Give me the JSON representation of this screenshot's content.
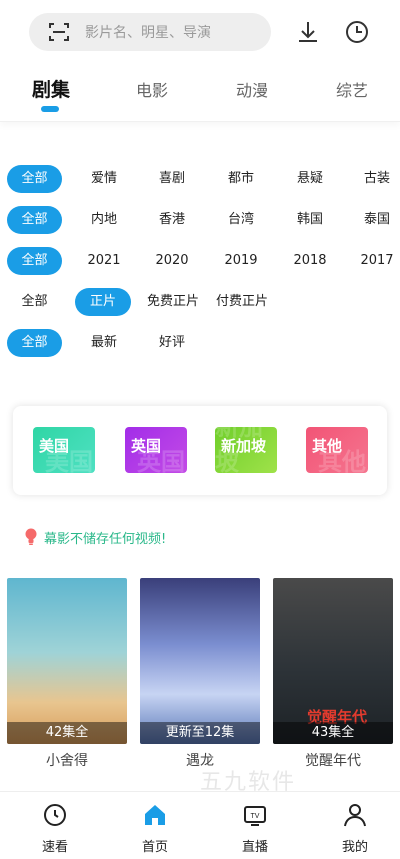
{
  "search": {
    "placeholder": "影片名、明星、导演"
  },
  "tabs": [
    {
      "label": "剧集",
      "active": true
    },
    {
      "label": "电影",
      "active": false
    },
    {
      "label": "动漫",
      "active": false
    },
    {
      "label": "综艺",
      "active": false
    }
  ],
  "filters": {
    "genre": [
      "全部",
      "爱情",
      "喜剧",
      "都市",
      "悬疑",
      "古装"
    ],
    "region": [
      "全部",
      "内地",
      "香港",
      "台湾",
      "韩国",
      "泰国"
    ],
    "year": [
      "全部",
      "2021",
      "2020",
      "2019",
      "2018",
      "2017"
    ],
    "pay": [
      "全部",
      "正片",
      "免费正片",
      "付费正片"
    ],
    "sort": [
      "全部",
      "最新",
      "好评"
    ]
  },
  "region_cards": [
    {
      "label": "美国",
      "color": "#2fd6a5"
    },
    {
      "label": "英国",
      "color": "#a22de8"
    },
    {
      "label": "新加坡",
      "color": "#6fce2a"
    },
    {
      "label": "其他",
      "color": "#f25476"
    }
  ],
  "notice": "幕影不储存任何视频!",
  "shows": [
    {
      "title": "小舍得",
      "badge": "42集全"
    },
    {
      "title": "遇龙",
      "badge": "更新至12集"
    },
    {
      "title": "觉醒年代",
      "badge": "43集全",
      "poster_text": "觉醒年代"
    }
  ],
  "bottom_nav": [
    {
      "label": "速看",
      "icon": "clock-icon"
    },
    {
      "label": "首页",
      "icon": "home-icon",
      "active": true
    },
    {
      "label": "直播",
      "icon": "tv-icon"
    },
    {
      "label": "我的",
      "icon": "user-icon"
    }
  ],
  "watermark": "五九软件",
  "accent_color": "#1a9de6"
}
